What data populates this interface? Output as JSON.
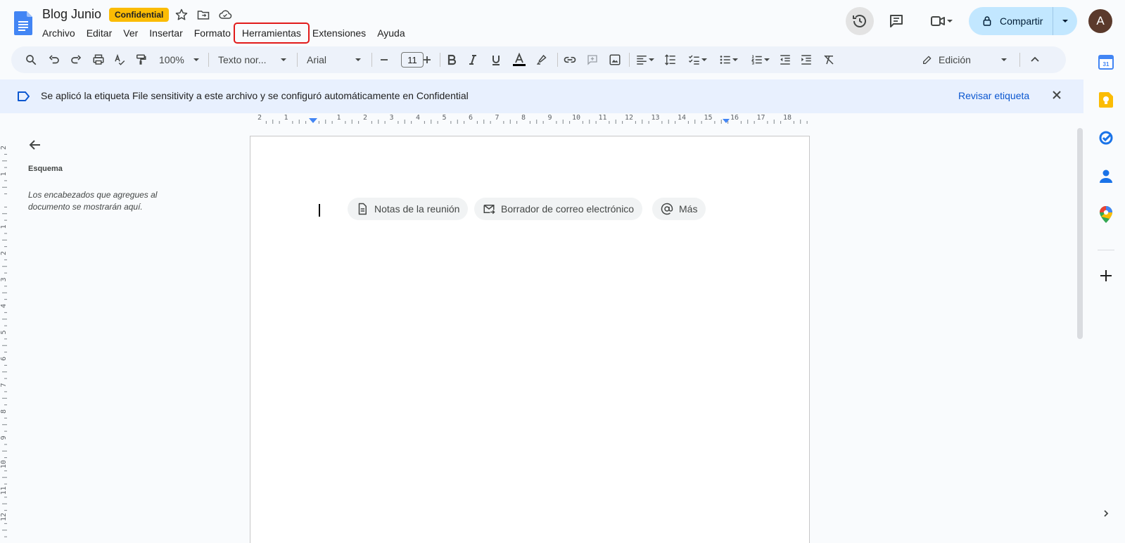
{
  "header": {
    "title": "Blog Junio",
    "badge": "Confidential",
    "menu": [
      "Archivo",
      "Editar",
      "Ver",
      "Insertar",
      "Formato",
      "Herramientas",
      "Extensiones",
      "Ayuda"
    ],
    "highlighted_menu": "Herramientas",
    "share_label": "Compartir",
    "avatar_letter": "A"
  },
  "toolbar": {
    "zoom": "100%",
    "style": "Texto nor...",
    "font": "Arial",
    "font_size": "11",
    "mode": "Edición"
  },
  "banner": {
    "text": "Se aplicó la etiqueta File sensitivity a este archivo y se configuró automáticamente en Confidential",
    "link": "Revisar etiqueta"
  },
  "outline": {
    "title": "Esquema",
    "hint": "Los encabezados que agregues al documento se mostrarán aquí."
  },
  "chips": [
    {
      "label": "Notas de la reunión",
      "icon": "document-icon"
    },
    {
      "label": "Borrador de correo electrónico",
      "icon": "mail-icon"
    },
    {
      "label": "Más",
      "icon": "at-icon"
    }
  ],
  "ruler": {
    "h_labels": [
      "2",
      "1",
      "",
      "1",
      "2",
      "3",
      "4",
      "5",
      "6",
      "7",
      "8",
      "9",
      "10",
      "11",
      "12",
      "13",
      "14",
      "15",
      "16",
      "17",
      "18"
    ],
    "v_labels": [
      "2",
      "1",
      "",
      "1",
      "2",
      "3",
      "4",
      "5",
      "6",
      "7",
      "8",
      "9",
      "10",
      "11",
      "12"
    ]
  },
  "colors": {
    "accent": "#0b57d0",
    "share_bg": "#c2e7ff",
    "banner_bg": "#e8f0fe",
    "badge_bg": "#fbbc04",
    "highlight": "#e11a1a"
  }
}
